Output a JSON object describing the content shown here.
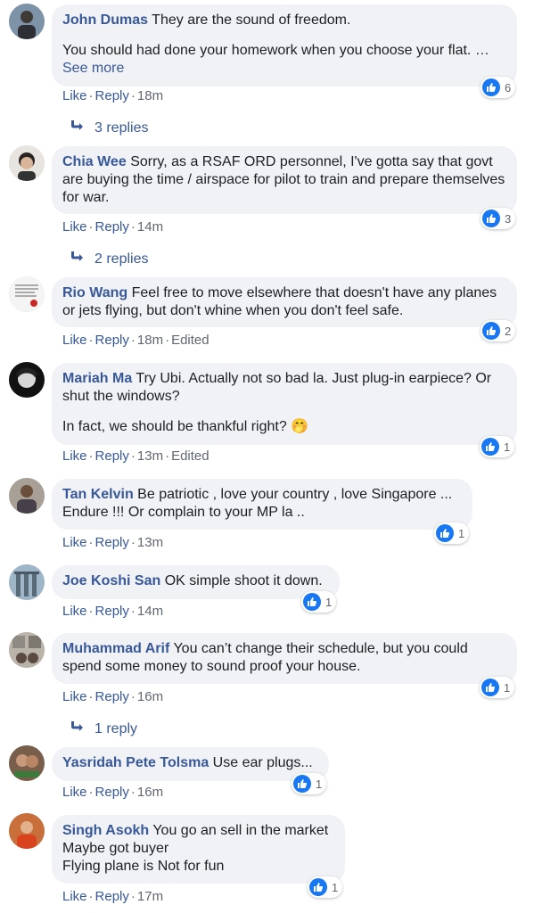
{
  "comments": [
    {
      "name": "John Dumas",
      "text": "They are the sound of freedom.",
      "text2": "You should had done your homework when you choose your flat. …",
      "see_more": "See more",
      "like": "Like",
      "reply": "Reply",
      "time": "18m",
      "reactions": "6",
      "replies": "3 replies"
    },
    {
      "name": "Chia Wee",
      "text": "Sorry, as a RSAF ORD personnel, I've gotta say that govt are buying the time / airspace for pilot to train and prepare themselves for war.",
      "like": "Like",
      "reply": "Reply",
      "time": "14m",
      "reactions": "3",
      "replies": "2 replies"
    },
    {
      "name": "Rio Wang",
      "text": "Feel free to move elsewhere that doesn't have any planes or jets flying, but don't whine when you don't feel safe.",
      "like": "Like",
      "reply": "Reply",
      "time": "18m",
      "edited": "Edited",
      "reactions": "2"
    },
    {
      "name": "Mariah Ma",
      "text": "Try Ubi. Actually not so bad la. Just plug-in earpiece? Or shut the windows?",
      "text2": "In fact, we should be thankful right? 🤭",
      "like": "Like",
      "reply": "Reply",
      "time": "13m",
      "edited": "Edited",
      "reactions": "1"
    },
    {
      "name": "Tan Kelvin",
      "text": "Be patriotic , love your country , love Singapore ... Endure !!! Or complain to your MP la ..",
      "like": "Like",
      "reply": "Reply",
      "time": "13m",
      "reactions": "1"
    },
    {
      "name": "Joe Koshi San",
      "text": "OK simple shoot it down.",
      "like": "Like",
      "reply": "Reply",
      "time": "14m",
      "reactions": "1"
    },
    {
      "name": "Muhammad Arif",
      "text": "You can’t change their schedule, but you could spend some money to sound proof your house.",
      "like": "Like",
      "reply": "Reply",
      "time": "16m",
      "reactions": "1",
      "replies": "1 reply"
    },
    {
      "name": "Yasridah Pete Tolsma",
      "text": "Use ear plugs...",
      "like": "Like",
      "reply": "Reply",
      "time": "16m",
      "reactions": "1"
    },
    {
      "name": "Singh Asokh",
      "text": "You go an sell in the market",
      "text_l2": "Maybe got buyer",
      "text_l3": "Flying plane is Not for fun",
      "like": "Like",
      "reply": "Reply",
      "time": "17m",
      "reactions": "1"
    }
  ],
  "colors": {
    "name": "#385898",
    "bubble": "#f0f2f5",
    "like_badge": "#1877f2",
    "meta": "#606770"
  },
  "icons": {
    "like": "thumbs-up-icon",
    "reply_arrow": "reply-arrow-icon"
  }
}
